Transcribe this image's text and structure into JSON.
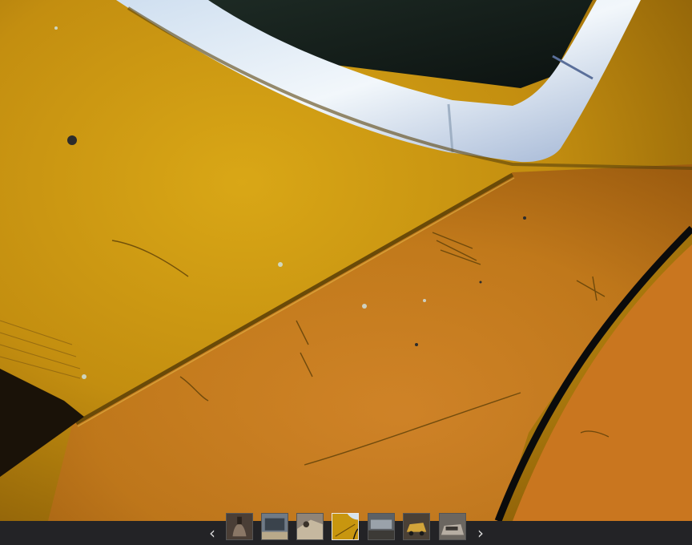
{
  "gallery": {
    "prev_glyph": "‹",
    "next_glyph": "›",
    "prev_icon": "chevron-left-icon",
    "next_icon": "chevron-right-icon",
    "active_index": 3,
    "thumbnail_count": 7,
    "colors": {
      "bar_background": "#232326",
      "paint_yellow": "#c8960f",
      "paint_orange": "#c97a1f",
      "chrome_trim": "#d7e3ee"
    }
  }
}
